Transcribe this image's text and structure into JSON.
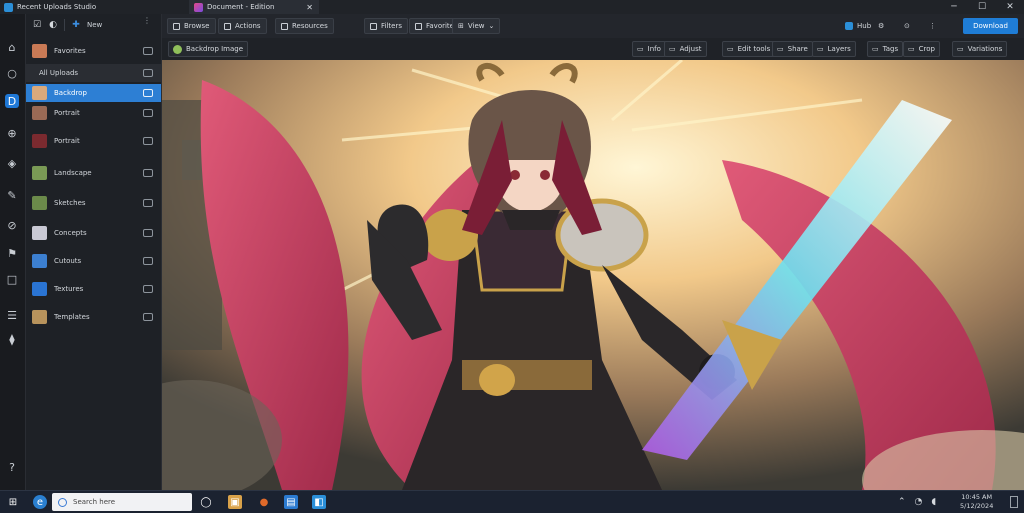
{
  "app": {
    "title": "Recent Uploads Studio"
  },
  "tab": {
    "label": "Document - Edition"
  },
  "window_controls": [
    "─",
    "☐",
    "✕"
  ],
  "left_rail": [
    {
      "name": "home-icon",
      "glyph": "⌂"
    },
    {
      "name": "circle-icon",
      "glyph": "○"
    },
    {
      "name": "library-icon",
      "glyph": "D",
      "active": true
    },
    {
      "name": "compass-icon",
      "glyph": "⊕"
    },
    {
      "name": "palette-icon",
      "glyph": "◈"
    },
    {
      "name": "brush-icon",
      "glyph": "✎"
    },
    {
      "name": "link-icon",
      "glyph": "⊘"
    },
    {
      "name": "flag-icon",
      "glyph": "⚑"
    },
    {
      "name": "square-icon",
      "glyph": "□"
    },
    {
      "name": "list-icon",
      "glyph": "☰"
    },
    {
      "name": "plugin-icon",
      "glyph": "⧫"
    },
    {
      "name": "help-icon",
      "glyph": "?"
    }
  ],
  "panel": {
    "top": {
      "add_label": "New",
      "filter_label": ""
    },
    "rows": [
      {
        "label": "Favorites",
        "thumb": "#c97a55"
      },
      {
        "label": "All Uploads",
        "thumb": "",
        "header": true
      },
      {
        "label": "Backdrop",
        "thumb": "#d9a97c",
        "selected": true
      },
      {
        "label": "Portrait",
        "thumb": "#9a6a55"
      },
      {
        "label": "Portrait",
        "thumb": "#7b2a2f"
      },
      {
        "label": "Landscape",
        "thumb": "#7a9a55"
      },
      {
        "label": "Sketches",
        "thumb": "#6b8a4a"
      },
      {
        "label": "Concepts",
        "thumb": "#c9c9d4"
      },
      {
        "label": "Cutouts",
        "thumb": "#3c7fd0"
      },
      {
        "label": "Textures",
        "thumb": "#2a74d3"
      },
      {
        "label": "Templates",
        "thumb": "#b8935c"
      }
    ]
  },
  "toolbar": {
    "buttons": [
      "Browse",
      "Actions",
      "Resources",
      "Filters",
      "Favorites"
    ],
    "view_label": "View",
    "right_items": [
      "Hub",
      "",
      ""
    ],
    "primary_label": "Download"
  },
  "subbar": {
    "asset_name": "Backdrop Image",
    "chips": [
      "Info",
      "Adjust",
      "Edit tools",
      "Share",
      "Layers",
      "Tags",
      "Crop",
      "Variations"
    ]
  },
  "taskbar": {
    "search_placeholder": "Search here",
    "time": "10:45 AM",
    "date": "5/12/2024"
  },
  "colors": {
    "accent": "#1f7dd6",
    "panel_bg": "#1e2126",
    "rail_bg": "#191b1f"
  }
}
